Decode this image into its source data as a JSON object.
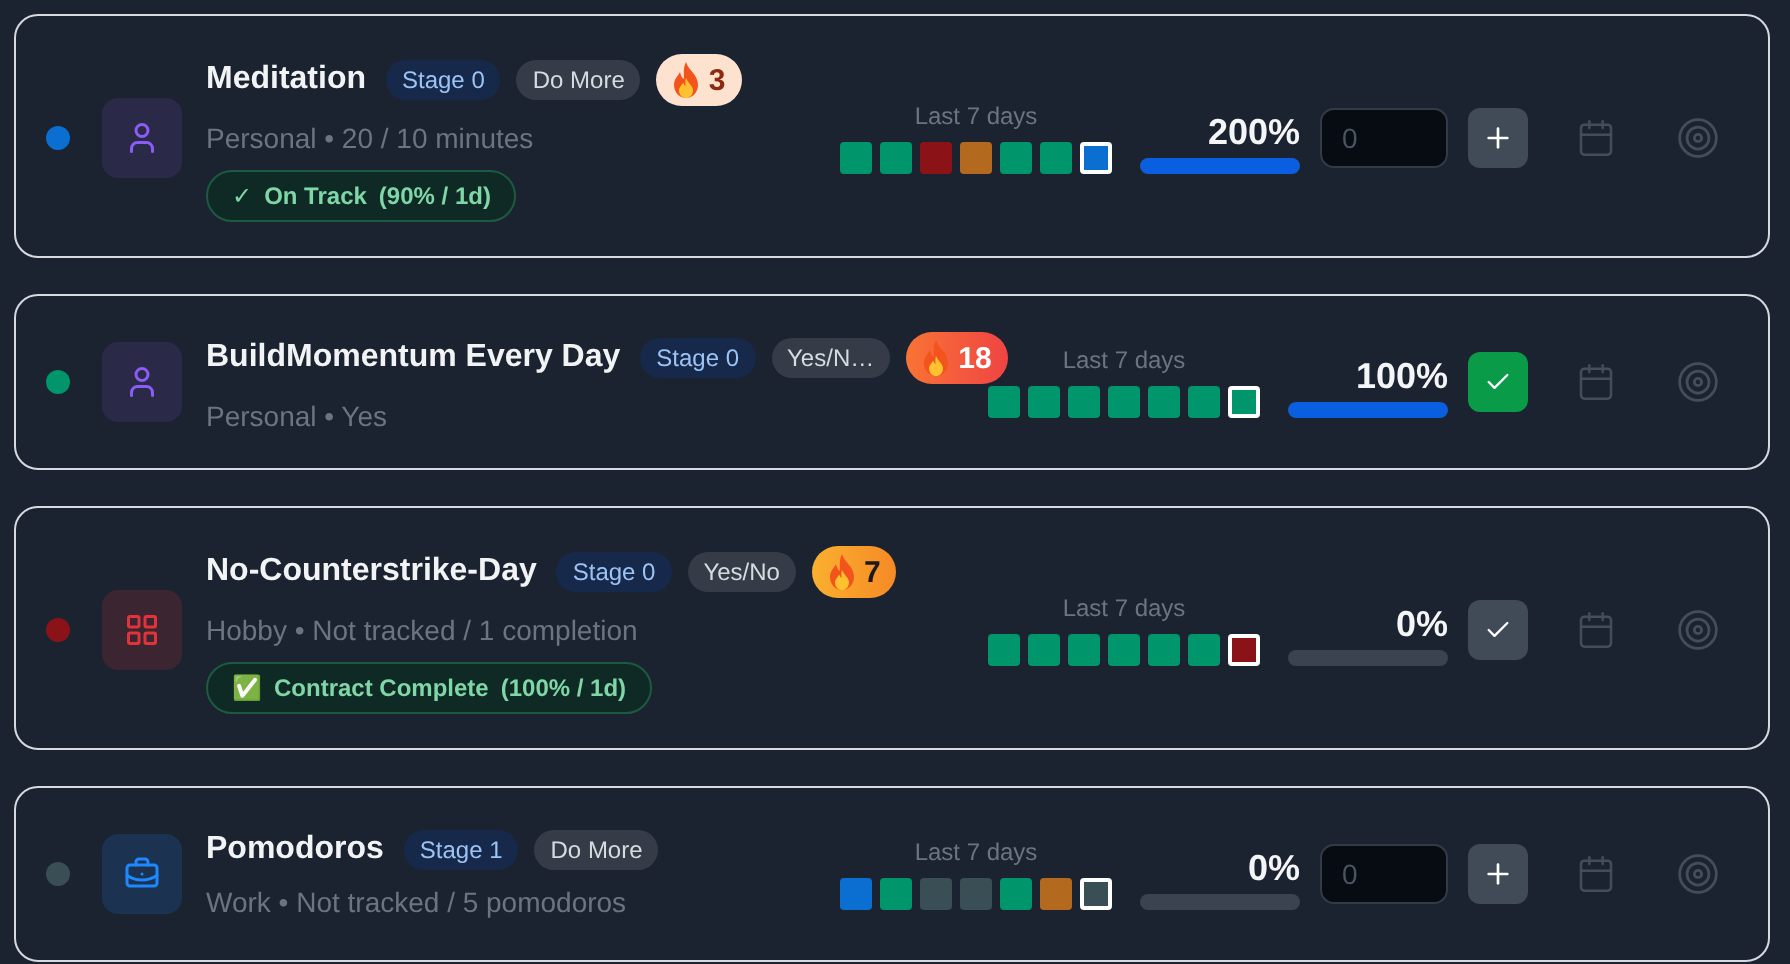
{
  "habits": [
    {
      "color": "#0a6fd0",
      "kind": "person",
      "name": "Meditation",
      "stage": "Stage 0",
      "type": "Do More",
      "streak": {
        "kind": "light",
        "count": "3"
      },
      "meta": "Personal • 20 / 10 minutes",
      "status": {
        "icon": "✓",
        "label": "On Track",
        "detail": "(90% / 1d)"
      },
      "history_label": "Last 7 days",
      "days": [
        {
          "color": "#00956a",
          "today": false
        },
        {
          "color": "#00956a",
          "today": false
        },
        {
          "color": "#8b1318",
          "today": false
        },
        {
          "color": "#b46a1e",
          "today": false
        },
        {
          "color": "#00956a",
          "today": false
        },
        {
          "color": "#00956a",
          "today": false
        },
        {
          "color": "#0a6fd0",
          "today": true
        }
      ],
      "percent": "200%",
      "level": 1,
      "action": {
        "kind": "counter",
        "placeholder": "0"
      }
    },
    {
      "color": "#00956a",
      "kind": "person",
      "name": "BuildMomentum Every Day",
      "stage": "Stage 0",
      "type": "Yes/N…",
      "streak": {
        "kind": "red",
        "count": "18"
      },
      "meta": "Personal • Yes",
      "history_label": "Last 7 days",
      "days": [
        {
          "color": "#00956a",
          "today": false
        },
        {
          "color": "#00956a",
          "today": false
        },
        {
          "color": "#00956a",
          "today": false
        },
        {
          "color": "#00956a",
          "today": false
        },
        {
          "color": "#00956a",
          "today": false
        },
        {
          "color": "#00956a",
          "today": false
        },
        {
          "color": "#00956a",
          "today": true
        }
      ],
      "percent": "100%",
      "level": 1,
      "action": {
        "kind": "check",
        "done": true
      }
    },
    {
      "color": "#8b1318",
      "kind": "grid",
      "name": "No-Counterstrike-Day",
      "stage": "Stage 0",
      "type": "Yes/No",
      "streak": {
        "kind": "orange",
        "count": "7"
      },
      "meta": "Hobby • Not tracked / 1 completion",
      "status": {
        "icon": "✅",
        "label": "Contract Complete",
        "detail": "(100% / 1d)"
      },
      "history_label": "Last 7 days",
      "days": [
        {
          "color": "#00956a",
          "today": false
        },
        {
          "color": "#00956a",
          "today": false
        },
        {
          "color": "#00956a",
          "today": false
        },
        {
          "color": "#00956a",
          "today": false
        },
        {
          "color": "#00956a",
          "today": false
        },
        {
          "color": "#00956a",
          "today": false
        },
        {
          "color": "#8b1318",
          "today": true
        }
      ],
      "percent": "0%",
      "level": 0,
      "action": {
        "kind": "check",
        "done": false
      }
    },
    {
      "color": "#3a4e55",
      "kind": "briefcase",
      "name": "Pomodoros",
      "stage": "Stage 1",
      "type": "Do More",
      "meta": "Work • Not tracked / 5 pomodoros",
      "history_label": "Last 7 days",
      "days": [
        {
          "color": "#0a6fd0",
          "today": false
        },
        {
          "color": "#00956a",
          "today": false
        },
        {
          "color": "#3a4e55",
          "today": false
        },
        {
          "color": "#3a4e55",
          "today": false
        },
        {
          "color": "#00956a",
          "today": false
        },
        {
          "color": "#b46a1e",
          "today": false
        },
        {
          "color": "#3a4e55",
          "today": true
        }
      ],
      "percent": "0%",
      "level": 0,
      "action": {
        "kind": "counter",
        "placeholder": "0"
      }
    }
  ]
}
